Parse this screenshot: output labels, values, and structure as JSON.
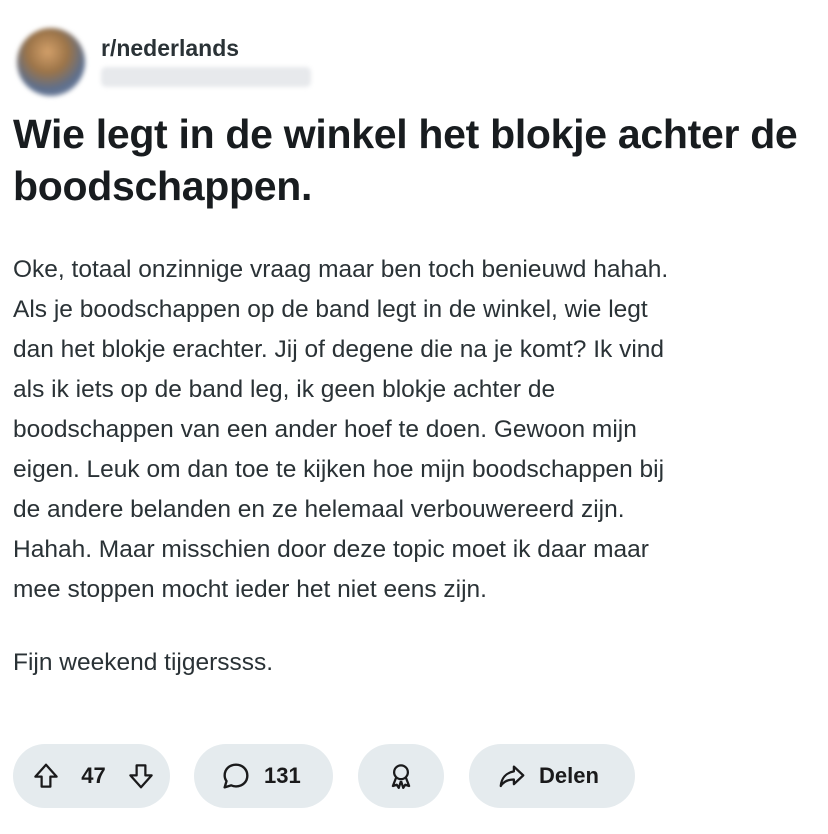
{
  "post": {
    "subreddit": "r/nederlands",
    "title": "Wie legt in de winkel het blokje achter de boodschappen.",
    "body": [
      "Oke, totaal onzinnige vraag maar ben toch benieuwd hahah.\nAls je boodschappen op de band legt in de winkel, wie legt\ndan het blokje erachter. Jij of degene die na je komt? Ik vind\nals ik iets op de band leg, ik geen blokje achter de\nboodschappen van een ander hoef te doen. Gewoon mijn\neigen. Leuk om dan toe te kijken hoe mijn boodschappen bij\nde andere belanden en ze helemaal verbouwereerd zijn.\nHahah. Maar misschien door deze topic moet ik daar maar\nmee stoppen mocht ieder het niet eens zijn.",
      "Fijn weekend tijgerssss."
    ]
  },
  "actions": {
    "vote_count": "47",
    "comment_count": "131",
    "share_label": "Delen"
  },
  "icons": {
    "upvote": "arrow-up-icon",
    "downvote": "arrow-down-icon",
    "comment": "comment-bubble-icon",
    "award": "award-icon",
    "share": "share-arrow-icon"
  },
  "colors": {
    "pill_background": "#e5ebee",
    "text": "#1a1a1b",
    "body_text": "#2a3236"
  }
}
